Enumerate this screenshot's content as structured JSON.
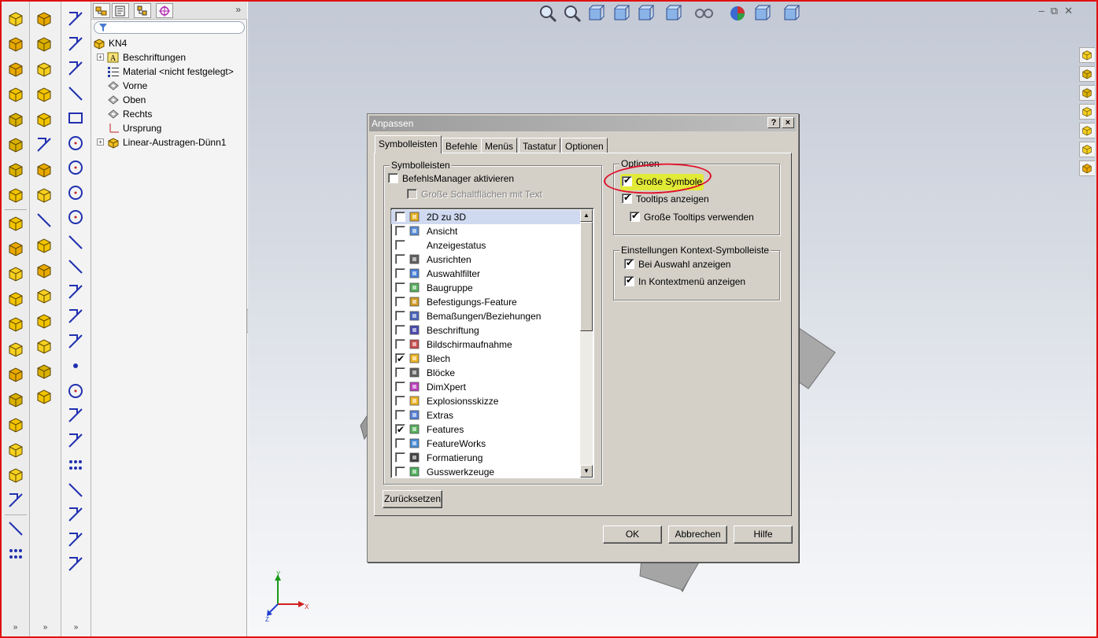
{
  "left_toolbar": {
    "col1_icons": [
      "extruded-boss-icon",
      "revolved-boss-icon",
      "swept-boss-icon",
      "lofted-boss-icon",
      "boundary-boss-icon",
      "extruded-cut-icon",
      "hole-wizard-icon",
      "revolved-cut-icon",
      "swept-cut-icon",
      "lofted-cut-icon",
      "boundary-cut-icon",
      "fillet-icon",
      "chamfer-icon",
      "rib-icon",
      "draft-icon",
      "shell-icon",
      "wrap-icon",
      "dome-icon",
      "intersect-icon",
      "mirror-icon",
      "linear-pattern-icon",
      "circular-pattern-icon"
    ],
    "col2_icons": [
      "sheet-metal-icon",
      "mold-tools-icon",
      "weldments-icon",
      "surfaces-icon",
      "planar-surface-icon",
      "offset-surface-icon",
      "move-face-icon",
      "delete-face-icon",
      "split-line-icon",
      "thicken-icon",
      "cut-with-surface-icon",
      "untrim-icon",
      "knit-icon",
      "fill-icon",
      "ruled-surface-icon",
      "extend-surface-icon"
    ],
    "col3_icons": [
      "sketch-icon",
      "3d-sketch-icon",
      "smart-dimension-icon",
      "line-icon",
      "rectangle-icon",
      "circle-icon",
      "center-arc-icon",
      "tangent-arc-icon",
      "three-point-arc-icon",
      "centerline-icon",
      "spline-icon",
      "text-sketch-icon",
      "polygon-icon",
      "slot-icon",
      "point-icon",
      "ellipse-icon",
      "offset-entities-icon",
      "hexagon-icon",
      "circular-sketch-pattern-icon",
      "linear-sketch-pattern-icon",
      "mirror-entities-icon",
      "construction-geometry-icon",
      "dimxpert-sketch-icon"
    ],
    "more_symbol": "»"
  },
  "feature_manager": {
    "tabs": [
      "featuremanager-tab-icon",
      "propertymanager-tab-icon",
      "configurationmanager-tab-icon",
      "dimxpertmanager-tab-icon"
    ],
    "more_symbol": "»",
    "tree": [
      {
        "label": "KN4",
        "icon": "part-icon",
        "expandable": false
      },
      {
        "label": "Beschriftungen",
        "icon": "annotations-icon",
        "expandable": true
      },
      {
        "label": "Material <nicht festgelegt>",
        "icon": "material-icon",
        "expandable": false
      },
      {
        "label": "Vorne",
        "icon": "plane-icon",
        "expandable": false
      },
      {
        "label": "Oben",
        "icon": "plane-icon",
        "expandable": false
      },
      {
        "label": "Rechts",
        "icon": "plane-icon",
        "expandable": false
      },
      {
        "label": "Ursprung",
        "icon": "origin-icon",
        "expandable": false
      },
      {
        "label": "Linear-Austragen-Dünn1",
        "icon": "feature-icon",
        "expandable": true
      }
    ]
  },
  "view_toolbar": {
    "icons": [
      "zoom-to-fit-icon",
      "zoom-to-area-icon",
      "previous-view-icon",
      "section-view-icon",
      "view-orientation-icon",
      "display-style-icon",
      "hide-show-items-icon",
      "edit-appearance-icon",
      "apply-scene-icon",
      "view-settings-icon"
    ]
  },
  "window_controls": {
    "minimize": "–",
    "restore": "⧉",
    "close": "✕"
  },
  "task_pane": {
    "icons": [
      "solidworks-resources-icon",
      "design-library-icon",
      "file-explorer-icon",
      "view-palette-icon",
      "appearances-icon",
      "custom-properties-icon",
      "3d-content-icon"
    ]
  },
  "triad": {
    "x": "X",
    "y": "Y",
    "z": "Z"
  },
  "dialog": {
    "title": "Anpassen",
    "help_btn": "?",
    "close_btn": "×",
    "tabs": [
      "Symbolleisten",
      "Befehle",
      "Menüs",
      "Tastatur",
      "Optionen"
    ],
    "active_tab": "Symbolleisten",
    "toolbars_group": {
      "title": "Symbolleisten",
      "commandmanager_label": "BefehlsManager aktivieren",
      "commandmanager_checked": false,
      "large_buttons_label": "Große Schaltflächen mit Text",
      "large_buttons_enabled": false,
      "list": [
        {
          "label": "2D zu 3D",
          "checked": false,
          "selected": true,
          "icon": "2d-to-3d-icon"
        },
        {
          "label": "Ansicht",
          "checked": false,
          "selected": false,
          "icon": "view-icon"
        },
        {
          "label": "Anzeigestatus",
          "checked": false,
          "selected": false,
          "icon": ""
        },
        {
          "label": "Ausrichten",
          "checked": false,
          "selected": false,
          "icon": "align-icon"
        },
        {
          "label": "Auswahlfilter",
          "checked": false,
          "selected": false,
          "icon": "selection-filter-icon"
        },
        {
          "label": "Baugruppe",
          "checked": false,
          "selected": false,
          "icon": "assembly-icon"
        },
        {
          "label": "Befestigungs-Feature",
          "checked": false,
          "selected": false,
          "icon": "fastening-feature-icon"
        },
        {
          "label": "Bemaßungen/Beziehungen",
          "checked": false,
          "selected": false,
          "icon": "dimensions-relations-icon"
        },
        {
          "label": "Beschriftung",
          "checked": false,
          "selected": false,
          "icon": "annotation-icon"
        },
        {
          "label": "Bildschirmaufnahme",
          "checked": false,
          "selected": false,
          "icon": "screen-capture-icon"
        },
        {
          "label": "Blech",
          "checked": true,
          "selected": false,
          "icon": "sheet-metal-icon"
        },
        {
          "label": "Blöcke",
          "checked": false,
          "selected": false,
          "icon": "blocks-icon"
        },
        {
          "label": "DimXpert",
          "checked": false,
          "selected": false,
          "icon": "dimxpert-icon"
        },
        {
          "label": "Explosionsskizze",
          "checked": false,
          "selected": false,
          "icon": "explode-sketch-icon"
        },
        {
          "label": "Extras",
          "checked": false,
          "selected": false,
          "icon": "tools-icon"
        },
        {
          "label": "Features",
          "checked": true,
          "selected": false,
          "icon": "features-icon"
        },
        {
          "label": "FeatureWorks",
          "checked": false,
          "selected": false,
          "icon": "featureworks-icon"
        },
        {
          "label": "Formatierung",
          "checked": false,
          "selected": false,
          "icon": "formatting-icon"
        },
        {
          "label": "Gusswerkzeuge",
          "checked": false,
          "selected": false,
          "icon": "mold-tools-icon"
        }
      ],
      "reset_btn": "Zurücksetzen"
    },
    "options_group": {
      "title": "Optionen",
      "items": [
        {
          "label": "Große Symbole",
          "checked": true,
          "indent": false
        },
        {
          "label": "Tooltips anzeigen",
          "checked": true,
          "indent": false
        },
        {
          "label": "Große Tooltips verwenden",
          "checked": true,
          "indent": true
        }
      ]
    },
    "context_group": {
      "title": "Einstellungen Kontext-Symbolleiste",
      "items": [
        {
          "label": "Bei Auswahl anzeigen",
          "checked": true
        },
        {
          "label": "In Kontextmenü anzeigen",
          "checked": true
        }
      ]
    },
    "buttons": {
      "ok": "OK",
      "cancel": "Abbrechen",
      "help": "Hilfe"
    }
  },
  "colors": {
    "highlight": "#e2ea38",
    "annotation_ellipse": "#e0102a",
    "dialog_face": "#d4d0c8"
  }
}
